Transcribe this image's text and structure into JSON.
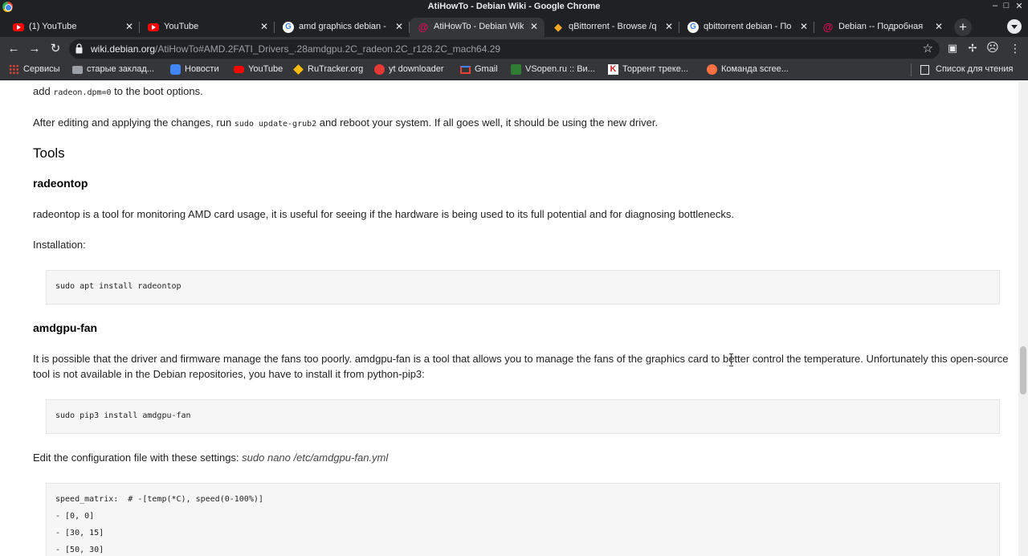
{
  "window": {
    "title": "AtiHowTo - Debian Wiki - Google Chrome"
  },
  "tabs": [
    {
      "label": "(1) YouTube",
      "icon": "youtube-icon"
    },
    {
      "label": "YouTube",
      "icon": "youtube-icon"
    },
    {
      "label": "amd graphics debian -",
      "icon": "google-icon"
    },
    {
      "label": "AtiHowTo - Debian Wiki",
      "icon": "debian-icon",
      "active": true
    },
    {
      "label": "qBittorrent - Browse /q",
      "icon": "sourceforge-icon"
    },
    {
      "label": "qbittorrent debian - По",
      "icon": "google-icon"
    },
    {
      "label": "Debian -- Подробная",
      "icon": "debian-icon"
    }
  ],
  "toolbar": {
    "url_host": "wiki.debian.org",
    "url_path": "/AtiHowTo#AMD.2FATI_Drivers_.28amdgpu.2C_radeon.2C_r128.2C_mach64.29"
  },
  "bookmarks": [
    {
      "label": "Сервисы",
      "icon": "apps-icon"
    },
    {
      "label": "старые заклад...",
      "icon": "folder-icon"
    },
    {
      "label": "Новости",
      "icon": "news-icon"
    },
    {
      "label": "YouTube",
      "icon": "youtube-icon"
    },
    {
      "label": "RuTracker.org",
      "icon": "rutracker-icon"
    },
    {
      "label": "yt downloader",
      "icon": "download-icon"
    },
    {
      "label": "Gmail",
      "icon": "gmail-icon"
    },
    {
      "label": "VSopen.ru :: Ви...",
      "icon": "vsopen-icon"
    },
    {
      "label": "Торрент треке...",
      "icon": "torrent-icon"
    },
    {
      "label": "Команда scree...",
      "icon": "team-icon"
    }
  ],
  "reading_list": "Список для чтения",
  "content": {
    "p_boot_pre": "add ",
    "p_boot_code": "radeon.dpm=0",
    "p_boot_post": " to the boot options.",
    "p_grub_pre": "After editing and applying the changes, run ",
    "p_grub_code": "sudo update-grub2",
    "p_grub_post": " and reboot your system. If all goes well, it should be using the new driver.",
    "h_tools": "Tools",
    "h_radeontop": "radeontop",
    "p_radeontop": "radeontop is a tool for monitoring AMD card usage, it is useful for seeing if the hardware is being used to its full potential and for diagnosing bottlenecks.",
    "p_installation": "Installation:",
    "code_radeontop": "sudo apt install radeontop",
    "h_amdgpufan": "amdgpu-fan",
    "p_amdgpufan_1": "It is possible that the driver and firmware manage the fans too poorly. amdgpu-fan is a tool that allows you to manage the fans of the graphics card to better control the temperature. Unfortunately this open-source",
    "p_amdgpufan_2": "tool is not available in the Debian repositories, you have to install it from python-pip3:",
    "code_amdgpufan": "sudo pip3 install amdgpu-fan",
    "p_edit_pre": "Edit the configuration file with these settings: ",
    "p_edit_em": "sudo nano /etc/amdgpu-fan.yml",
    "config_lines": [
      "speed_matrix:  # -[temp(*C), speed(0-100%)]",
      "- [0, 0]",
      "- [30, 15]",
      "- [50, 30]"
    ]
  }
}
